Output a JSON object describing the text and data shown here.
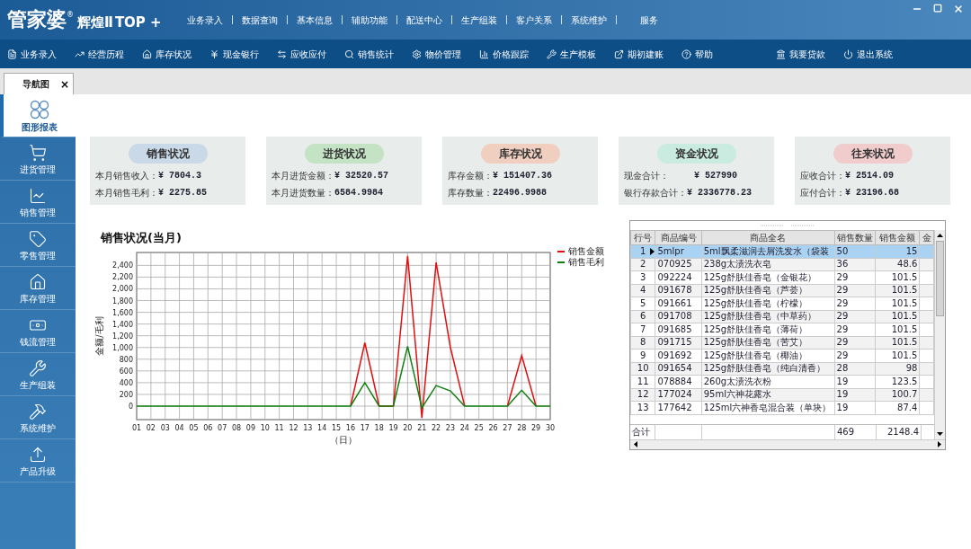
{
  "brand": {
    "name": "管家婆",
    "mark": "®",
    "edition": "辉煌Ⅱ",
    "edition_suffix": "TOP +"
  },
  "top_menu": [
    "业务录入",
    "数据查询",
    "基本信息",
    "辅助功能",
    "配送中心",
    "生产组装",
    "客户关系",
    "系统维护",
    "服务"
  ],
  "toolbar": [
    "业务录入",
    "经营历程",
    "库存状况",
    "现金银行",
    "应收应付",
    "销售统计",
    "物价管理",
    "价格跟踪",
    "生产模板",
    "期初建账",
    "帮助",
    "我要贷款",
    "退出系统"
  ],
  "doc_tab": {
    "label": "导航图",
    "close": "×"
  },
  "sidebar": [
    {
      "label": "图形报表",
      "selected": true
    },
    {
      "label": "进货管理",
      "selected": false
    },
    {
      "label": "销售管理",
      "selected": false
    },
    {
      "label": "零售管理",
      "selected": false
    },
    {
      "label": "库存管理",
      "selected": false
    },
    {
      "label": "钱流管理",
      "selected": false
    },
    {
      "label": "生产组装",
      "selected": false
    },
    {
      "label": "系统维护",
      "selected": false
    },
    {
      "label": "产品升级",
      "selected": false
    }
  ],
  "cards": [
    {
      "title": "销售状况",
      "color": "#c9d9e8",
      "rows": [
        [
          "本月销售收入：",
          "¥ 7804.3"
        ],
        [
          "本月销售毛利：",
          "¥ 2275.85"
        ]
      ]
    },
    {
      "title": "进货状况",
      "color": "#c4e3c4",
      "rows": [
        [
          "本月进货金额：",
          "¥ 32520.57"
        ],
        [
          "本月进货数量：",
          "6584.9984"
        ]
      ]
    },
    {
      "title": "库存状况",
      "color": "#f0cfc0",
      "rows": [
        [
          "库存金额：",
          "¥ 151407.36"
        ],
        [
          "库存数量：",
          "22496.9988"
        ]
      ]
    },
    {
      "title": "资金状况",
      "color": "#c9ebe0",
      "rows": [
        [
          "现金合计：",
          "¥ 527990"
        ],
        [
          "银行存款合计：",
          "¥ 2336778.23"
        ]
      ]
    },
    {
      "title": "往来状况",
      "color": "#f0cccc",
      "rows": [
        [
          "应收合计：",
          "¥ 2514.09"
        ],
        [
          "应付合计：",
          "¥ 23196.68"
        ]
      ]
    }
  ],
  "chart": {
    "chart_data": {
      "type": "line",
      "title": "销售状况(当月)",
      "xlabel": "（日）",
      "ylabel": "金额/毛利",
      "categories": [
        "01",
        "02",
        "03",
        "04",
        "05",
        "06",
        "07",
        "08",
        "09",
        "10",
        "11",
        "12",
        "13",
        "14",
        "15",
        "16",
        "17",
        "18",
        "19",
        "20",
        "21",
        "22",
        "23",
        "24",
        "25",
        "26",
        "27",
        "28",
        "29",
        "30"
      ],
      "ylim": [
        -230,
        2620
      ],
      "grid": true,
      "legend": "right",
      "yticks": [
        {
          "value": 0,
          "label": "0"
        },
        {
          "value": 200,
          "label": "200"
        },
        {
          "value": 400,
          "label": "400"
        },
        {
          "value": 600,
          "label": "600"
        },
        {
          "value": 800,
          "label": "800"
        },
        {
          "value": 1000,
          "label": "1,000"
        },
        {
          "value": 1200,
          "label": "1,200"
        },
        {
          "value": 1400,
          "label": "1,400"
        },
        {
          "value": 1600,
          "label": "1,600"
        },
        {
          "value": 1800,
          "label": "1,800"
        },
        {
          "value": 2000,
          "label": "2,000"
        },
        {
          "value": 2200,
          "label": "2,200"
        },
        {
          "value": 2400,
          "label": "2,400"
        }
      ],
      "series": [
        {
          "name": "销售金额",
          "color": "#e01010",
          "values": [
            null,
            null,
            null,
            null,
            null,
            null,
            null,
            null,
            null,
            null,
            null,
            null,
            null,
            null,
            null,
            0,
            1080,
            0,
            0,
            2560,
            -200,
            2450,
            1000,
            0,
            null,
            null,
            0,
            860,
            0,
            null
          ]
        },
        {
          "name": "销售毛利",
          "color": "#108010",
          "values": [
            0,
            0,
            0,
            0,
            0,
            0,
            0,
            0,
            0,
            0,
            0,
            0,
            0,
            0,
            0,
            0,
            400,
            0,
            0,
            1020,
            -30,
            350,
            260,
            0,
            0,
            0,
            0,
            270,
            0,
            0
          ]
        }
      ]
    }
  },
  "table": {
    "columns": [
      "行号",
      "商品编号",
      "商品全名",
      "销售数量",
      "销售金额",
      "金"
    ],
    "rows": [
      {
        "cells": [
          "1",
          "5mlpr",
          "5ml飘柔滋润去屑洗发水（袋装",
          "50",
          "15"
        ],
        "selected": true
      },
      {
        "cells": [
          "2",
          "070925",
          "238g太渍洗衣皂",
          "36",
          "48.6"
        ],
        "selected": false
      },
      {
        "cells": [
          "3",
          "092224",
          "125g舒肤佳香皂（金银花）",
          "29",
          "101.5"
        ],
        "selected": false
      },
      {
        "cells": [
          "4",
          "091678",
          "125g舒肤佳香皂（芦荟）",
          "29",
          "101.5"
        ],
        "selected": false
      },
      {
        "cells": [
          "5",
          "091661",
          "125g舒肤佳香皂（柠檬）",
          "29",
          "101.5"
        ],
        "selected": false
      },
      {
        "cells": [
          "6",
          "091708",
          "125g舒肤佳香皂（中草药）",
          "29",
          "101.5"
        ],
        "selected": false
      },
      {
        "cells": [
          "7",
          "091685",
          "125g舒肤佳香皂（薄荷）",
          "29",
          "101.5"
        ],
        "selected": false
      },
      {
        "cells": [
          "8",
          "091715",
          "125g舒肤佳香皂（苦艾）",
          "29",
          "101.5"
        ],
        "selected": false
      },
      {
        "cells": [
          "9",
          "091692",
          "125g舒肤佳香皂（椰油）",
          "29",
          "101.5"
        ],
        "selected": false
      },
      {
        "cells": [
          "10",
          "091654",
          "125g舒肤佳香皂（纯白清香）",
          "28",
          "98"
        ],
        "selected": false
      },
      {
        "cells": [
          "11",
          "078884",
          "260g太渍洗衣粉",
          "19",
          "123.5"
        ],
        "selected": false
      },
      {
        "cells": [
          "12",
          "177024",
          "95ml六神花露水",
          "19",
          "100.7"
        ],
        "selected": false
      },
      {
        "cells": [
          "13",
          "177642",
          "125ml六神香皂混合装（单块）",
          "19",
          "87.4"
        ],
        "selected": false
      }
    ],
    "footer": {
      "column_1": "合计",
      "column_4": "469",
      "column_5": "2148.4"
    }
  }
}
